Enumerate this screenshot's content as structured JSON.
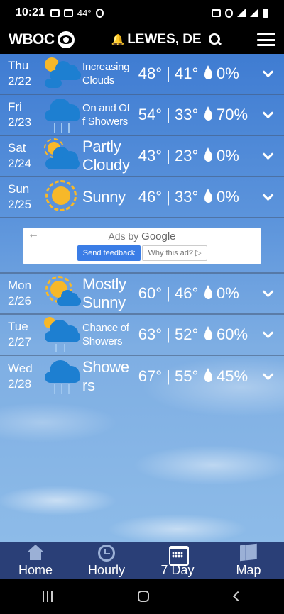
{
  "status_bar": {
    "time": "10:21",
    "temp": "44°",
    "icons": [
      "gmail-icon",
      "gmail-icon",
      "notification-icon",
      "lock-icon",
      "location-icon",
      "wifi-icon",
      "signal-icon",
      "battery-icon"
    ]
  },
  "header": {
    "brand": "WBOC",
    "location": "LEWES, DE"
  },
  "forecast": [
    {
      "day": "Thu",
      "date": "2/22",
      "condition": "Increasing Clouds",
      "high": "48°",
      "low": "41°",
      "precip": "0%",
      "icon": "partly-cloudy"
    },
    {
      "day": "Fri",
      "date": "2/23",
      "condition": "On and Off Showers",
      "high": "54°",
      "low": "33°",
      "precip": "70%",
      "icon": "showers"
    },
    {
      "day": "Sat",
      "date": "2/24",
      "condition": "Partly Cloudy",
      "high": "43°",
      "low": "23°",
      "precip": "0%",
      "icon": "partly-cloudy"
    },
    {
      "day": "Sun",
      "date": "2/25",
      "condition": "Sunny",
      "high": "46°",
      "low": "33°",
      "precip": "0%",
      "icon": "sunny"
    },
    {
      "day": "Mon",
      "date": "2/26",
      "condition": "Mostly Sunny",
      "high": "60°",
      "low": "46°",
      "precip": "0%",
      "icon": "mostly-sunny"
    },
    {
      "day": "Tue",
      "date": "2/27",
      "condition": "Chance of Showers",
      "high": "63°",
      "low": "52°",
      "precip": "60%",
      "icon": "showers"
    },
    {
      "day": "Wed",
      "date": "2/28",
      "condition": "Showers",
      "high": "67°",
      "low": "55°",
      "precip": "45%",
      "icon": "showers"
    }
  ],
  "ad": {
    "ads_by": "Ads by",
    "google": "Google",
    "feedback": "Send feedback",
    "why": "Why this ad? ▷"
  },
  "nav": {
    "home": "Home",
    "hourly": "Hourly",
    "seven_day": "7 Day",
    "map": "Map"
  },
  "colors": {
    "nav_bg": "#2a3f77",
    "cloud": "#1d7fd1",
    "sun": "#f7b829",
    "ad_button": "#3b7de6"
  }
}
